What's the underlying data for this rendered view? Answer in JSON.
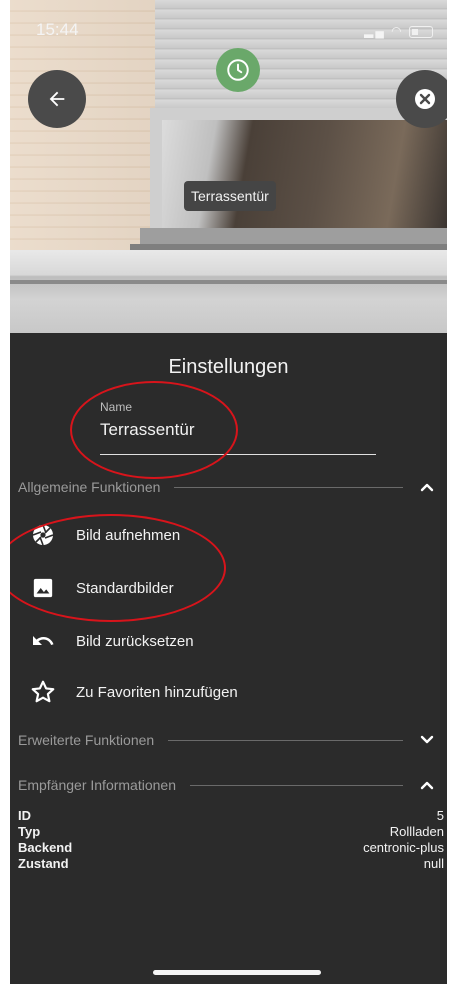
{
  "status_bar": {
    "time": "15:44"
  },
  "photo": {
    "device_label": "Terrassentür"
  },
  "header": {
    "title": "Einstellungen"
  },
  "name_field": {
    "label": "Name",
    "value": "Terrassentür"
  },
  "sections": {
    "general": {
      "label": "Allgemeine Funktionen",
      "items": [
        {
          "label": "Bild aufnehmen",
          "icon": "camera-shutter-icon"
        },
        {
          "label": "Standardbilder",
          "icon": "image-icon"
        },
        {
          "label": "Bild zurücksetzen",
          "icon": "undo-icon"
        },
        {
          "label": "Zu Favoriten hinzufügen",
          "icon": "star-outline-icon"
        }
      ]
    },
    "advanced": {
      "label": "Erweiterte Funktionen"
    },
    "receiver": {
      "label": "Empfänger Informationen",
      "rows": [
        {
          "key": "ID",
          "value": "5"
        },
        {
          "key": "Typ",
          "value": "Rollladen"
        },
        {
          "key": "Backend",
          "value": "centronic-plus"
        },
        {
          "key": "Zustand",
          "value": "null"
        }
      ]
    }
  },
  "colors": {
    "background": "#2b2b2b",
    "text": "#f2f2f2",
    "muted": "#9a9a9a",
    "annotation": "#d8141b",
    "timer": "#6aa86a"
  }
}
